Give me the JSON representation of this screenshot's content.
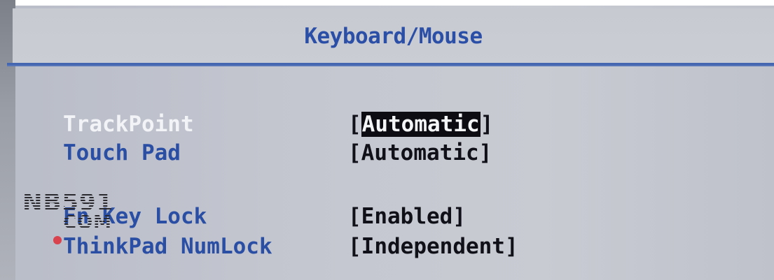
{
  "title": "Keyboard/Mouse",
  "settings": [
    {
      "label": "TrackPoint",
      "value": "Automatic",
      "selected": true
    },
    {
      "label": "Touch Pad",
      "value": "Automatic",
      "selected": false
    },
    {
      "label": "Fn Key Lock",
      "value": "Enabled",
      "selected": false
    },
    {
      "label": "ThinkPad NumLock",
      "value": "Independent",
      "selected": false
    }
  ],
  "watermark": {
    "line1": "NB591",
    "line2": "COM"
  },
  "colors": {
    "title": "#2b4fa6",
    "label": "#2a4ea4",
    "selected_label": "#f2f3f6",
    "value": "#101018",
    "highlight_bg": "#0c0c12",
    "background": "#c6c8d1"
  }
}
